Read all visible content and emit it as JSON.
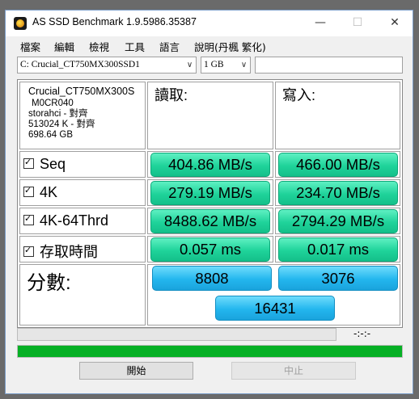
{
  "window": {
    "title": "AS SSD Benchmark 1.9.5986.35387",
    "minimize": "—",
    "maximize": "☐",
    "close": "✕"
  },
  "menu": [
    "檔案",
    "編輯",
    "檢視",
    "工具",
    "語言",
    "說明(丹楓 繁化)"
  ],
  "drive_select": {
    "value": "C: Crucial_CT750MX300SSD1"
  },
  "size_select": {
    "value": "1 GB"
  },
  "drive_info": {
    "model": "Crucial_CT750MX300S",
    "firmware": "M0CR040",
    "driver": "storahci - 對齊",
    "alignment": "513024 K - 對齊",
    "capacity": "698.64 GB"
  },
  "headers": {
    "read": "讀取:",
    "write": "寫入:"
  },
  "rows": [
    {
      "label": "Seq",
      "read": "404.86 MB/s",
      "write": "466.00 MB/s"
    },
    {
      "label": "4K",
      "read": "279.19 MB/s",
      "write": "234.70 MB/s"
    },
    {
      "label": "4K-64Thrd",
      "read": "8488.62 MB/s",
      "write": "2794.29 MB/s"
    },
    {
      "label": "存取時間",
      "read": "0.057 ms",
      "write": "0.017 ms"
    }
  ],
  "score": {
    "label": "分數:",
    "read": "8808",
    "write": "3076",
    "total": "16431"
  },
  "status": {
    "time": "-:-:-",
    "progress_fraction": 1.0
  },
  "buttons": {
    "start": "開始",
    "stop": "中止"
  },
  "colors": {
    "result_green": "#1fd39a",
    "score_blue": "#23b6ee",
    "progress_green": "#06b025"
  }
}
